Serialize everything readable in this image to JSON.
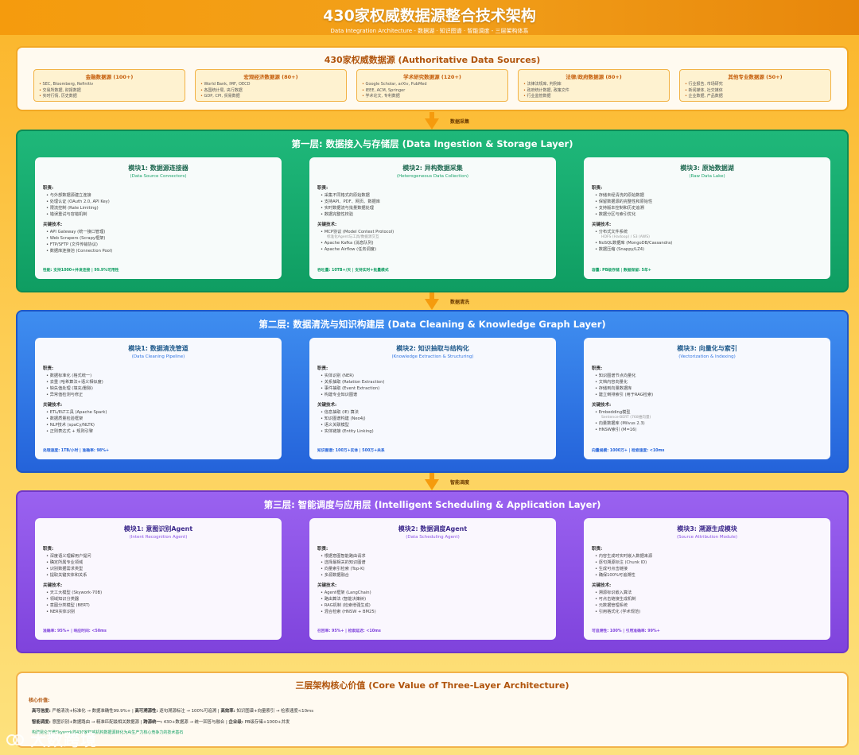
{
  "header": {
    "title": "430家权威数据源整合技术架构",
    "subtitle": "Data Integration Architecture - 数据湖 · 知识图谱 · 智能调度 - 三层架构体系"
  },
  "sources": {
    "title": "430家权威数据源 (Authoritative Data Sources)",
    "boxes": [
      {
        "title": "金融数据源 (100+)",
        "items": [
          "SEC, Bloomberg, Refinitiv",
          "交易所数据, 财报数据",
          "实时行情, 历史数据"
        ]
      },
      {
        "title": "宏观经济数据源 (80+)",
        "items": [
          "World Bank, IMF, OECD",
          "各国统计局, 央行数据",
          "GDP, CPI, 贸易数据"
        ]
      },
      {
        "title": "学术研究数据源 (120+)",
        "items": [
          "Google Scholar, arXiv, PubMed",
          "IEEE, ACM, Springer",
          "学术论文, 专利数据"
        ]
      },
      {
        "title": "法律/政府数据源 (80+)",
        "items": [
          "法律法规库, 判例库",
          "政府统计数据, 政策文件",
          "行业监管数据"
        ]
      },
      {
        "title": "其他专业数据源 (50+)",
        "items": [
          "行业报告, 市场研究",
          "新闻媒体, 社交媒体",
          "企业数据, 产品数据"
        ]
      }
    ]
  },
  "arrows": {
    "a1": "数据采集",
    "a2": "数据清洗",
    "a3": "智能调度"
  },
  "layers": [
    {
      "title": "第一层: 数据接入与存储层 (Data Ingestion & Storage Layer)",
      "modules": [
        {
          "title": "模块1: 数据源连接器",
          "subtitle": "(Data Source Connectors)",
          "duties_label": "职责:",
          "duties": [
            "与外部数据源建立连接",
            "处理认证 (OAuth 2.0, API Key)",
            "限流控制 (Rate Limiting)",
            "错误重试与容错机制"
          ],
          "tech_label": "关键技术:",
          "tech": [
            {
              "text": "API Gateway (统一接口管理)"
            },
            {
              "text": "Web Scrapers (Scrapy框架)"
            },
            {
              "text": "FTP/SFTP (文件传输协议)"
            },
            {
              "text": "数据库连接池 (Connection Pool)"
            }
          ],
          "stat": "性能: 支持1000+并发连接 | 99.9%可用性"
        },
        {
          "title": "模块2: 异构数据采集",
          "subtitle": "(Heterogeneous Data Collection)",
          "duties_label": "职责:",
          "duties": [
            "采集不同格式的原始数据",
            "支持API、PDF、网页、数据库",
            "实时数据流与批量数据处理",
            "数据完整性校验"
          ],
          "tech_label": "关键技术:",
          "tech": [
            {
              "text": "MCP协议 (Model Context Protocol)",
              "note": "标准化Agent与工具/数据源交互"
            },
            {
              "text": "Apache Kafka (消息队列)"
            },
            {
              "text": "Apache Airflow (任务调度)"
            }
          ],
          "stat": "吞吐量: 10TB+/天 | 支持实时+批量模式"
        },
        {
          "title": "模块3: 原始数据湖",
          "subtitle": "(Raw Data Lake)",
          "duties_label": "职责:",
          "duties": [
            "存储未经清洗的原始数据",
            "保留数据源的完整性和原始性",
            "支持版本控制和历史追溯",
            "数据分区与索引优化"
          ],
          "tech_label": "关键技术:",
          "tech": [
            {
              "text": "分布式文件系统",
              "note": "HDFS (Hadoop) / S3 (AWS)"
            },
            {
              "text": "NoSQL数据库 (MongoDB/Cassandra)"
            },
            {
              "text": "数据压缩 (Snappy/LZ4)"
            }
          ],
          "stat": "容量: PB级存储 | 数据保留: 5年+"
        }
      ]
    },
    {
      "title": "第二层: 数据清洗与知识构建层 (Data Cleaning & Knowledge Graph Layer)",
      "modules": [
        {
          "title": "模块1: 数据清洗管道",
          "subtitle": "(Data Cleaning Pipeline)",
          "duties_label": "职责:",
          "duties": [
            "数据标准化 (格式统一)",
            "去重 (哈希算法+语义相似度)",
            "缺失值处理 (填充/删除)",
            "异常值检测与修正"
          ],
          "tech_label": "关键技术:",
          "tech": [
            {
              "text": "ETL/ELT工具 (Apache Spark)"
            },
            {
              "text": "数据质量检验框架"
            },
            {
              "text": "NLP技术 (spaCy/NLTK)"
            },
            {
              "text": "正则表达式 + 规则引擎"
            }
          ],
          "stat": "处理速度: 1TB/小时 | 准确率: 98%+"
        },
        {
          "title": "模块2: 知识抽取与结构化",
          "subtitle": "(Knowledge Extraction & Structuring)",
          "duties_label": "职责:",
          "duties": [
            "实体识别 (NER)",
            "关系抽取 (Relation Extraction)",
            "事件抽取 (Event Extraction)",
            "构建专业知识图谱"
          ],
          "tech_label": "关键技术:",
          "tech": [
            {
              "text": "信息抽取 (IE) 算法"
            },
            {
              "text": "知识图谱构建 (Neo4j)"
            },
            {
              "text": "语义关联模型"
            },
            {
              "text": "实体链接 (Entity Linking)"
            }
          ],
          "stat": "知识图谱: 100万+实体 | 500万+关系"
        },
        {
          "title": "模块3: 向量化与索引",
          "subtitle": "(Vectorization & Indexing)",
          "duties_label": "职责:",
          "duties": [
            "知识图谱节点向量化",
            "文档内容向量化",
            "存储到向量数据库",
            "建立倒排索引 (用于RAG检索)"
          ],
          "tech_label": "关键技术:",
          "tech": [
            {
              "text": "Embedding模型",
              "note": "Sentence-BERT (768维向量)"
            },
            {
              "text": "向量数据库 (Milvus 2.3)"
            },
            {
              "text": "HNSW索引 (M=16)"
            }
          ],
          "stat": "向量规模: 1000万+ | 检索速度: <10ms"
        }
      ]
    },
    {
      "title": "第三层: 智能调度与应用层 (Intelligent Scheduling & Application Layer)",
      "modules": [
        {
          "title": "模块1: 意图识别Agent",
          "subtitle": "(Intent Recognition Agent)",
          "duties_label": "职责:",
          "duties": [
            "深度语义理解用户提问",
            "确定所属专业领域",
            "识别数据需求类型",
            "提取关键实体和关系"
          ],
          "tech_label": "关键技术:",
          "tech": [
            {
              "text": "天工大模型 (Skywork-70B)"
            },
            {
              "text": "领域知识分类器"
            },
            {
              "text": "意图分类模型 (BERT)"
            },
            {
              "text": "NER实体识别"
            }
          ],
          "stat": "准确率: 95%+ | 响应时间: <50ms"
        },
        {
          "title": "模块2: 数据调度Agent",
          "subtitle": "(Data Scheduling Agent)",
          "duties_label": "职责:",
          "duties": [
            "根据意图智能路由请求",
            "选择最相关的知识图谱",
            "向量索引检索 (Top-K)",
            "多源数据融合"
          ],
          "tech_label": "关键技术:",
          "tech": [
            {
              "text": "Agent框架 (LangChain)"
            },
            {
              "text": "路由算法 (智能决策树)"
            },
            {
              "text": "RAG机制 (检索增强生成)"
            },
            {
              "text": "混合检索 (HNSW + BM25)"
            }
          ],
          "stat": "召回率: 95%+ | 检索延迟: <10ms"
        },
        {
          "title": "模块3: 溯源生成模块",
          "subtitle": "(Source Attribution Module)",
          "duties_label": "职责:",
          "duties": [
            "内容生成时实时嵌入数据来源",
            "逐句溯源标注 (Chunk ID)",
            "生成可点击链接",
            "确保100%可追溯性"
          ],
          "tech_label": "关键技术:",
          "tech": [
            {
              "text": "溯源标识嵌入算法"
            },
            {
              "text": "可点击链接生成机制"
            },
            {
              "text": "元数据管理系统"
            },
            {
              "text": "引用格式化 (学术规范)"
            }
          ],
          "stat": "可追溯性: 100% | 引用准确率: 99%+"
        }
      ]
    }
  ],
  "core": {
    "title": "三层架构核心价值 (Core Value of Three-Layer Architecture)",
    "label": "核心价值:",
    "line1": [
      {
        "k": "高可信度:",
        "v": "严格清洗+标准化 → 数据准确性99.9%+"
      },
      {
        "k": "高可溯源性:",
        "v": "逐句溯源标注 → 100%可追溯"
      },
      {
        "k": "高效率:",
        "v": "知识图谱+向量索引 → 检索速度<10ms"
      }
    ],
    "line2": [
      {
        "k": "智能调度:",
        "v": "意图识别+数据路由 → 精准匹配最相关数据源"
      },
      {
        "k": "跨源统一:",
        "v": "430+数据源 → 统一回答与融合"
      },
      {
        "k": "企业级:",
        "v": "PB级存储+1000+并发"
      }
    ],
    "footer": "构建昆仑万维Skywork将430家权威机构数据源转化为AI生产力核心竞争力的技术基石"
  },
  "watermark": "大数跨境",
  "colors": {
    "accent_orange": "#f59b0d",
    "layer1_green": "#0f9d62",
    "layer2_blue": "#2463da",
    "layer3_purple": "#7f43dc"
  }
}
